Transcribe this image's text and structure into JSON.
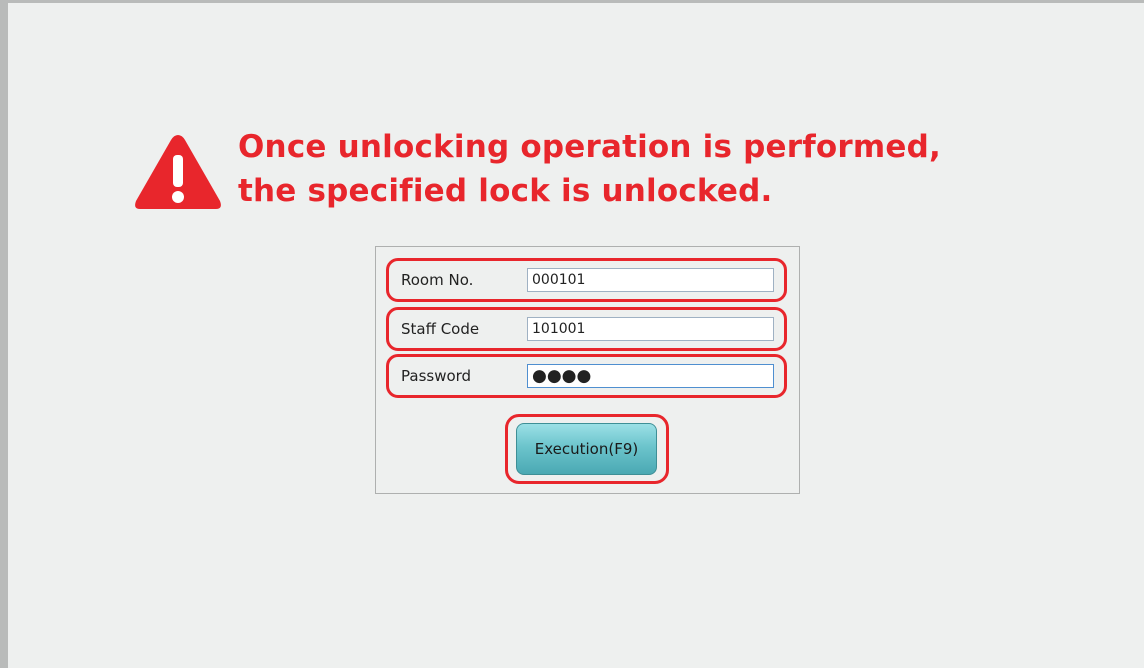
{
  "warning": {
    "line1": "Once unlocking operation is performed,",
    "line2": "the specified lock is unlocked.",
    "icon": "warning-triangle-icon",
    "color": "#e8262c"
  },
  "form": {
    "room": {
      "label": "Room No.",
      "value": "000101"
    },
    "staff": {
      "label": "Staff Code",
      "value": "101001"
    },
    "password": {
      "label": "Password",
      "display": "●●●●"
    },
    "execute_label": "Execution(F9)"
  },
  "colors": {
    "highlight": "#e8262c",
    "button": "#6cc4cc",
    "background": "#eef0ef"
  }
}
